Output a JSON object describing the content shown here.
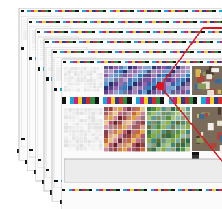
{
  "illustration": {
    "subject": "stack-of-printed-color-test-charts",
    "sheet_count": 6,
    "pointer_color": "#e0141e",
    "ink_colors": {
      "cyan": "#16a6dc",
      "magenta": "#d61f7c",
      "yellow": "#f5d316",
      "black": "#141414",
      "blue": "#2b3a96",
      "red": "#d22a26",
      "green": "#2a8c45"
    }
  }
}
